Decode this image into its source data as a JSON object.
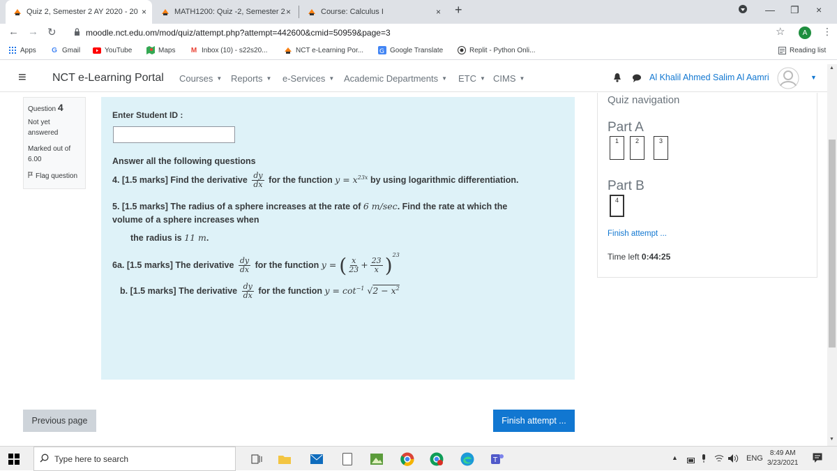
{
  "browser": {
    "tabs": [
      {
        "label": "Quiz 2, Semester 2 AY 2020 - 202",
        "active": true
      },
      {
        "label": "MATH1200: Quiz -2, Semester 2,",
        "active": false
      },
      {
        "label": "Course: Calculus I",
        "active": false
      }
    ],
    "new_tab": "+",
    "close_glyph": "×",
    "url": "moodle.nct.edu.om/mod/quiz/attempt.php?attempt=442600&cmid=50959&page=3",
    "profile_initial": "A",
    "bookmarks": [
      "Apps",
      "Gmail",
      "YouTube",
      "Maps",
      "Inbox (10) - s22s20...",
      "NCT e-Learning Por...",
      "Google Translate",
      "Replit - Python Onli..."
    ],
    "reading_list": "Reading list"
  },
  "site": {
    "title": "NCT e-Learning Portal",
    "nav": [
      "Courses",
      "Reports",
      "e-Services",
      "Academic Departments",
      "ETC",
      "CIMS"
    ],
    "user": "Al Khalil Ahmed Salim Al Aamri"
  },
  "question": {
    "label": "Question",
    "number": "4",
    "status": "Not yet answered",
    "marked": "Marked out of 6.00",
    "flag": "Flag question"
  },
  "content": {
    "student_id_label": "Enter Student ID :",
    "instruction": "Answer all the following questions",
    "q4_prefix": "4. [1.5 marks] Find the derivative",
    "q4_mid": "for the function",
    "q4_suffix": "by using logarithmic differentiation.",
    "q5_line1": "5.  [1.5 marks] The radius of a sphere increases at the rate of",
    "q5_rate": "6 m/sec",
    "q5_line1_end": ". Find the rate at which the",
    "q5_line2": "volume of a sphere increases when",
    "q5_line3": "the radius is",
    "q5_radius": "11 m",
    "q6a_prefix": "6a.  [1.5 marks] The derivative",
    "q6a_mid": "for the function",
    "q6b_prefix": "b.  [1.5 marks] The derivative",
    "q6b_mid": "for the function"
  },
  "quiz_nav": {
    "title": "Quiz navigation",
    "part_a": "Part A",
    "part_a_questions": [
      "1",
      "2",
      "3"
    ],
    "part_b": "Part B",
    "part_b_questions": [
      "4"
    ],
    "finish_link": "Finish attempt ...",
    "time_left_label": "Time left",
    "time_left": "0:44:25"
  },
  "buttons": {
    "previous": "Previous page",
    "finish": "Finish attempt ..."
  },
  "taskbar": {
    "search_placeholder": "Type here to search",
    "lang": "ENG",
    "time": "8:49 AM",
    "date": "3/23/2021"
  },
  "colors": {
    "accent": "#1177d1",
    "question_bg": "#def2f8",
    "nav_link": "#1177d1"
  }
}
